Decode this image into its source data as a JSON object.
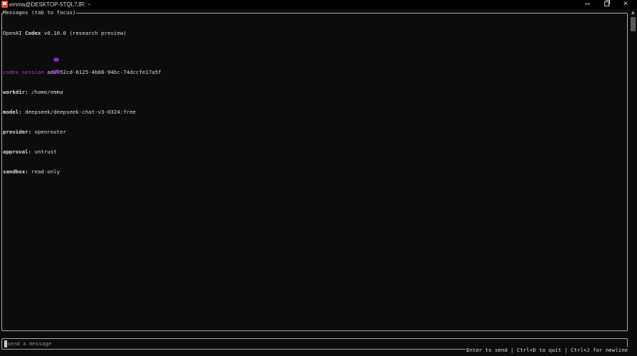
{
  "window": {
    "title": "emma@DESKTOP-5TQL7JR: ~",
    "controls": {
      "minimize": "minimize-icon",
      "maximize": "restore-icon",
      "close": "✕"
    }
  },
  "messages_panel": {
    "label": "Messages (tab to focus)",
    "lines": {
      "header_name": "OpenAI ",
      "header_brand": "Codex",
      "header_rest": " v0.10.0 (research preview)",
      "session_label": "codex session",
      "session_id": " ad6452cd-6125-4b08-94bc-74dccfe17a5f",
      "workdir_label": "workdir:",
      "workdir_value": " /home/emma",
      "model_label": "model:",
      "model_value": " deepseek/deepseek-chat-v3-0324:free",
      "provider_label": "provider:",
      "provider_value": " openrouter",
      "approval_label": "approval:",
      "approval_value": " untrust",
      "sandbox_label": "sandbox:",
      "sandbox_value": " read-only"
    }
  },
  "input": {
    "placeholder": "send a message",
    "help": "Enter to send | Ctrl+D to quit | Ctrl+J for newline"
  },
  "colors": {
    "background": "#0c0c0c",
    "text": "#dddddd",
    "accent_magenta": "#b03bc4",
    "border": "#a8a8a8"
  }
}
